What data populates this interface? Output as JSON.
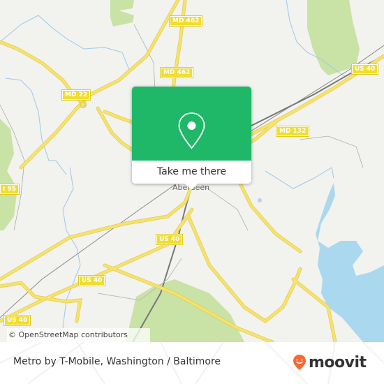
{
  "map": {
    "attribution": "© OpenStreetMap contributors",
    "place_label": "Aberdeen",
    "shields": [
      {
        "id": "md462-top",
        "label": "MD 462"
      },
      {
        "id": "md462-mid",
        "label": "MD 462"
      },
      {
        "id": "md22",
        "label": "MD 22"
      },
      {
        "id": "i95",
        "label": "I 95"
      },
      {
        "id": "us40-ne",
        "label": "US 40"
      },
      {
        "id": "md132",
        "label": "MD 132"
      },
      {
        "id": "us40-center",
        "label": "US 40"
      },
      {
        "id": "us40-mid",
        "label": "US 40"
      },
      {
        "id": "us40-sw",
        "label": "US 40"
      }
    ],
    "colors": {
      "land": "#f2f2ef",
      "road": "#f7e36a",
      "water": "#aad8ee",
      "park": "#c9e2a5",
      "rail": "#777777"
    }
  },
  "popup": {
    "icon": "map-pin-icon",
    "button_label": "Take me there",
    "color": "#1fb868"
  },
  "footer": {
    "title": "Metro by T-Mobile, Washington / Baltimore",
    "brand": "moovit",
    "brand_color": "#f26a36"
  }
}
